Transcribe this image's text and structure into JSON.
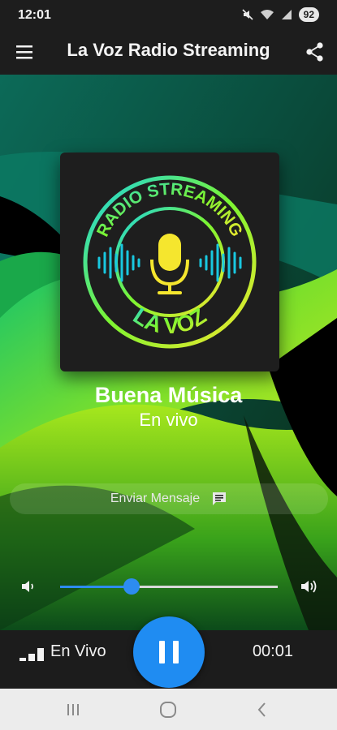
{
  "status_bar": {
    "time": "12:01",
    "battery": "92"
  },
  "app_bar": {
    "title": "La Voz Radio Streaming"
  },
  "album": {
    "top_text": "RADIO STREAMING",
    "bottom_text": "LA VOZ"
  },
  "now_playing": {
    "title": "Buena Música",
    "subtitle": "En vivo"
  },
  "message_button": {
    "label": "Enviar Mensaje"
  },
  "volume": {
    "level_fraction": 0.33
  },
  "player": {
    "live_label": "En Vivo",
    "elapsed": "00:01",
    "state": "playing"
  },
  "colors": {
    "accent": "#1f8cf2",
    "neon_green": "#7cf531",
    "neon_cyan": "#19d3e6",
    "neon_yellow": "#f5e62e"
  },
  "icons": [
    "menu-icon",
    "share-icon",
    "mute-icon",
    "wifi-icon",
    "battery-icon",
    "message-icon",
    "volume-low-icon",
    "volume-high-icon",
    "signal-icon",
    "pause-icon",
    "recents-icon",
    "home-icon",
    "back-icon"
  ]
}
